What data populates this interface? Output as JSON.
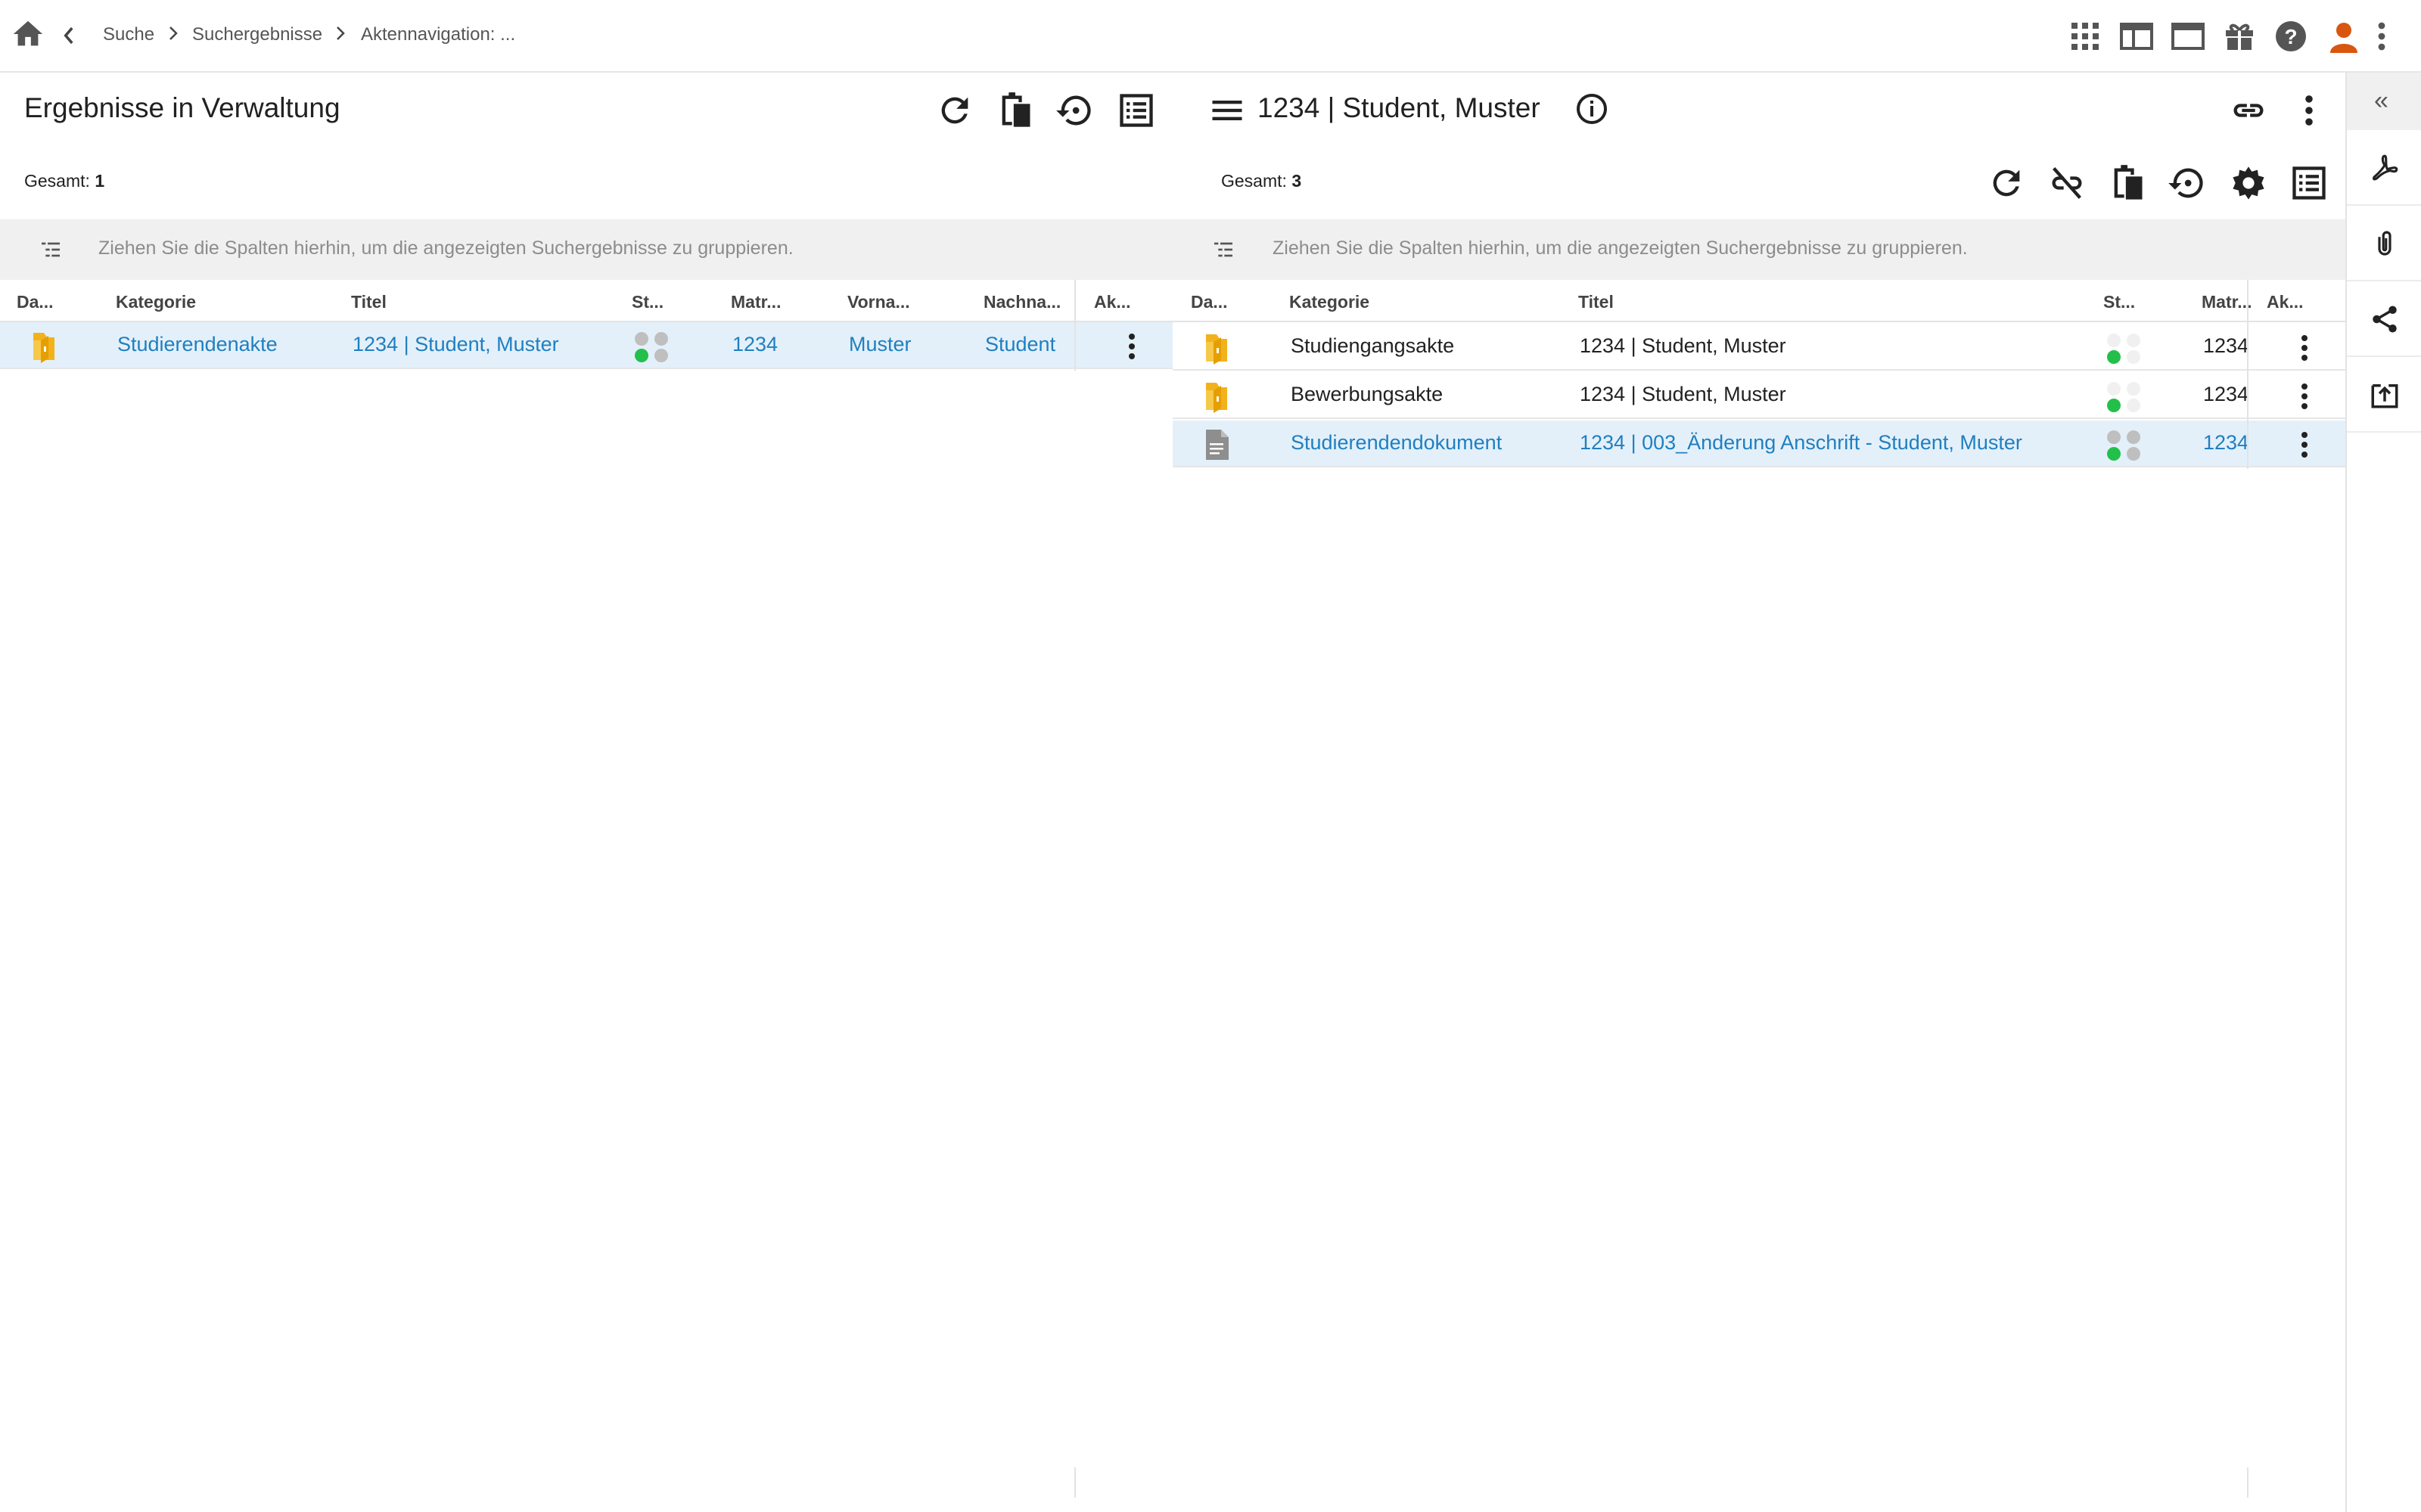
{
  "breadcrumb": {
    "items": [
      "Suche",
      "Suchergebnisse",
      "Aktennavigation: ..."
    ]
  },
  "topbar_icons": [
    "apps-grid-icon",
    "layout-columns-icon",
    "window-icon",
    "gift-icon",
    "help-icon",
    "user-avatar-icon",
    "more-vert-icon"
  ],
  "colors": {
    "link": "#1f7fc0",
    "folder": "#f2b21c",
    "status_green": "#22c04a",
    "status_grey": "#bfbfbf",
    "selected_row": "#e3f0fa",
    "avatar": "#d9560f"
  },
  "left_pane": {
    "title": "Ergebnisse in Verwaltung",
    "total_label": "Gesamt:",
    "total_value": "1",
    "group_hint": "Ziehen Sie die Spalten hierhin, um die angezeigten Suchergebnisse zu gruppieren.",
    "columns": [
      "Da...",
      "Kategorie",
      "Titel",
      "St...",
      "Matr...",
      "Vorna...",
      "Nachna...",
      "Ak..."
    ],
    "rows": [
      {
        "type": "folder",
        "kategorie": "Studierendenakte",
        "titel": "1234 | Student, Muster",
        "matr": "1234",
        "vorname": "Muster",
        "nachname": "Student",
        "selected": true
      }
    ]
  },
  "right_pane": {
    "title": "1234 | Student, Muster",
    "total_label": "Gesamt:",
    "total_value": "3",
    "group_hint": "Ziehen Sie die Spalten hierhin, um die angezeigten Suchergebnisse zu gruppieren.",
    "columns": [
      "Da...",
      "Kategorie",
      "Titel",
      "St...",
      "Matr...",
      "Ak..."
    ],
    "rows": [
      {
        "type": "folder",
        "kategorie": "Studiengangsakte",
        "titel": "1234 | Student, Muster",
        "matr": "1234",
        "selected": false
      },
      {
        "type": "folder",
        "kategorie": "Bewerbungsakte",
        "titel": "1234 | Student, Muster",
        "matr": "1234",
        "selected": false
      },
      {
        "type": "document",
        "kategorie": "Studierendendokument",
        "titel": "1234 | 003_Änderung Anschrift - Student, Muster",
        "matr": "1234",
        "selected": true
      }
    ]
  },
  "sidebar": {
    "collapse_label": "«",
    "items": [
      "pdf-icon",
      "attachment-icon",
      "share-icon",
      "upload-icon"
    ]
  }
}
